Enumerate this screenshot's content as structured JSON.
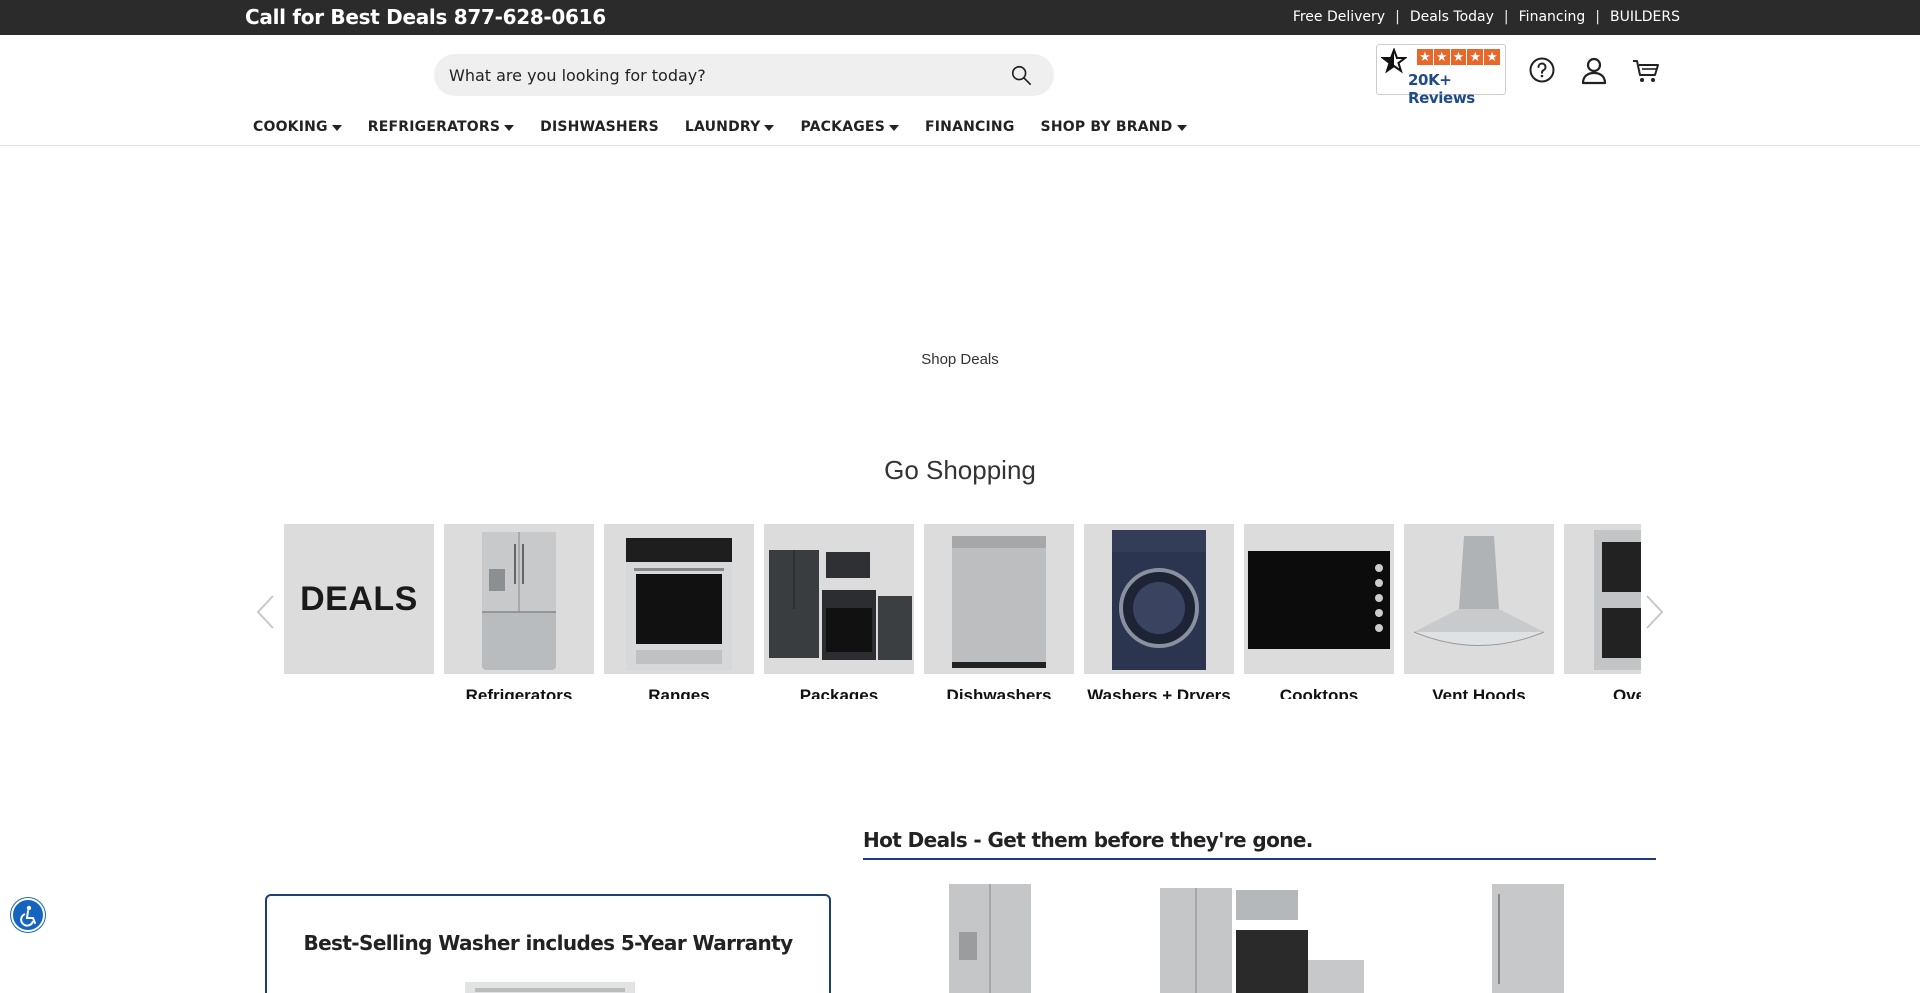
{
  "topbar": {
    "phone": "Call for Best Deals 877-628-0616",
    "links": [
      "Free Delivery",
      "Deals Today",
      "Financing",
      "BUILDERS"
    ],
    "separator": "|"
  },
  "search": {
    "placeholder": "What are you looking for today?"
  },
  "reviews": {
    "count": "20K+ Reviews",
    "stars": 5
  },
  "nav": [
    {
      "label": "COOKING",
      "dropdown": true
    },
    {
      "label": "REFRIGERATORS",
      "dropdown": true
    },
    {
      "label": "DISHWASHERS",
      "dropdown": false
    },
    {
      "label": "LAUNDRY",
      "dropdown": true
    },
    {
      "label": "PACKAGES",
      "dropdown": true
    },
    {
      "label": "FINANCING",
      "dropdown": false
    },
    {
      "label": "SHOP BY BRAND",
      "dropdown": true
    }
  ],
  "hero": {
    "shop_deals": "Shop Deals"
  },
  "shopping": {
    "title": "Go Shopping",
    "deals_tile": "DEALS",
    "categories": [
      "Refrigerators",
      "Ranges",
      "Packages",
      "Dishwashers",
      "Washers + Dryers",
      "Cooktops",
      "Vent Hoods",
      "Ovens"
    ]
  },
  "hot_deals": {
    "title": "Hot Deals - Get them before they're gone."
  },
  "promo": {
    "title": "Best-Selling Washer includes 5-Year Warranty"
  },
  "colors": {
    "topbar": "#2b2b2b",
    "accent": "#1c3f74",
    "review_star": "#e8672a",
    "a11y": "#1565c0"
  }
}
